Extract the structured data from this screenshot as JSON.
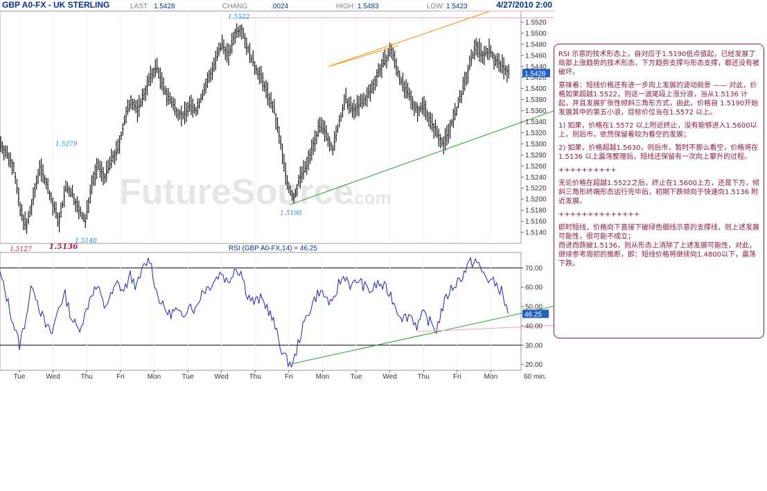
{
  "header": {
    "title": "GBP A0-FX - UK STERLING",
    "last_label": "LAST:",
    "last_value": "1.5428",
    "change_label": "CHANG",
    "change_value": ".0024",
    "high_label": "HIGH:",
    "high_value": "1.5483",
    "low_label": "LOW:",
    "low_value": "1.5423",
    "datetime": "4/27/2010 2:00"
  },
  "watermark": {
    "main": "FutureSource",
    "suffix": ".com"
  },
  "chart_data": [
    {
      "type": "bar",
      "subtype": "ohlc-price",
      "title": "GBP A0-FX - UK STERLING",
      "interval": "60 min.",
      "ylim": [
        1.512,
        1.554
      ],
      "yticks": [
        "1.5520",
        "1.5500",
        "1.5480",
        "1.5460",
        "1.5440",
        "1.5420",
        "1.5400",
        "1.5380",
        "1.5360",
        "1.5340",
        "1.5320",
        "1.5300",
        "1.5280",
        "1.5260",
        "1.5240",
        "1.5220",
        "1.5200",
        "1.5180",
        "1.5160",
        "1.5140"
      ],
      "last_value_label": "1.5428",
      "x_labels": [
        "Tue",
        "Wed",
        "Thu",
        "Fri",
        "Mon",
        "Tue",
        "Wed",
        "Thu",
        "Fri",
        "Mon",
        "Tue",
        "Wed",
        "Thu",
        "Fri",
        "Mon"
      ],
      "x_unit_label": "60 min.",
      "close_path": [
        [
          0,
          1.53
        ],
        [
          4,
          1.528
        ],
        [
          8,
          1.526
        ],
        [
          12,
          1.518
        ],
        [
          16,
          1.515
        ],
        [
          20,
          1.52
        ],
        [
          24,
          1.526
        ],
        [
          28,
          1.523
        ],
        [
          32,
          1.519
        ],
        [
          36,
          1.516
        ],
        [
          40,
          1.522
        ],
        [
          44,
          1.521
        ],
        [
          48,
          1.518
        ],
        [
          52,
          1.516
        ],
        [
          56,
          1.523
        ],
        [
          60,
          1.526
        ],
        [
          64,
          1.524
        ],
        [
          68,
          1.527
        ],
        [
          72,
          1.529
        ],
        [
          76,
          1.534
        ],
        [
          80,
          1.538
        ],
        [
          84,
          1.536
        ],
        [
          88,
          1.539
        ],
        [
          92,
          1.542
        ],
        [
          96,
          1.544
        ],
        [
          100,
          1.54
        ],
        [
          104,
          1.538
        ],
        [
          108,
          1.536
        ],
        [
          112,
          1.535
        ],
        [
          116,
          1.537
        ],
        [
          120,
          1.536
        ],
        [
          124,
          1.539
        ],
        [
          128,
          1.542
        ],
        [
          132,
          1.545
        ],
        [
          136,
          1.548
        ],
        [
          140,
          1.546
        ],
        [
          144,
          1.55
        ],
        [
          148,
          1.551
        ],
        [
          152,
          1.547
        ],
        [
          156,
          1.544
        ],
        [
          160,
          1.542
        ],
        [
          164,
          1.539
        ],
        [
          168,
          1.536
        ],
        [
          172,
          1.53
        ],
        [
          176,
          1.523
        ],
        [
          180,
          1.52
        ],
        [
          184,
          1.524
        ],
        [
          188,
          1.526
        ],
        [
          192,
          1.53
        ],
        [
          196,
          1.533
        ],
        [
          200,
          1.532
        ],
        [
          204,
          1.529
        ],
        [
          208,
          1.534
        ],
        [
          212,
          1.538
        ],
        [
          216,
          1.536
        ],
        [
          220,
          1.537
        ],
        [
          224,
          1.538
        ],
        [
          228,
          1.54
        ],
        [
          232,
          1.543
        ],
        [
          236,
          1.545
        ],
        [
          240,
          1.547
        ],
        [
          244,
          1.543
        ],
        [
          248,
          1.54
        ],
        [
          252,
          1.538
        ],
        [
          256,
          1.536
        ],
        [
          260,
          1.537
        ],
        [
          264,
          1.534
        ],
        [
          268,
          1.532
        ],
        [
          272,
          1.53
        ],
        [
          276,
          1.533
        ],
        [
          280,
          1.536
        ],
        [
          284,
          1.54
        ],
        [
          288,
          1.544
        ],
        [
          292,
          1.548
        ],
        [
          296,
          1.546
        ],
        [
          300,
          1.547
        ],
        [
          304,
          1.545
        ],
        [
          308,
          1.544
        ],
        [
          312,
          1.5428
        ]
      ],
      "annotations": [
        {
          "text": "1.5522",
          "x": 146,
          "y": 1.553,
          "color": "blue"
        },
        {
          "text": "1.5279",
          "x": 40,
          "y": 1.53,
          "color": "blue"
        },
        {
          "text": "1.5127",
          "x": 12,
          "y": 1.511,
          "color": "red"
        },
        {
          "text": "1.5136",
          "x": 36,
          "y": 1.5114,
          "color": "red-big"
        },
        {
          "text": "1.5140",
          "x": 52,
          "y": 1.5125,
          "color": "blue"
        },
        {
          "text": "1.5190",
          "x": 178,
          "y": 1.5175,
          "color": "blue"
        }
      ],
      "trendlines": [
        {
          "color": "orange",
          "from": [
            202,
            1.544
          ],
          "to": [
            301,
            1.554
          ]
        },
        {
          "color": "orange",
          "from": [
            202,
            1.544
          ],
          "to": [
            245,
            1.5478
          ]
        },
        {
          "color": "green",
          "from": [
            178,
            1.519
          ],
          "to": [
            320,
            1.536
          ]
        },
        {
          "color": "pink",
          "from": [
            146,
            1.5528
          ],
          "to": [
            320,
            1.5528
          ]
        },
        {
          "color": "pink",
          "from": [
            270,
            1.554
          ],
          "to": [
            320,
            1.554
          ]
        }
      ]
    },
    {
      "type": "line",
      "title": "RSI (GBP A0-FX,14) = 46.25",
      "series": [
        {
          "name": "RSI (GBP A0-FX,14)"
        }
      ],
      "ylim": [
        17,
        78
      ],
      "yticks": [
        "70.00",
        "60.00",
        "50.00",
        "40.00",
        "30.00",
        "20.00"
      ],
      "hlines": [
        70,
        30
      ],
      "last_value_label": "46.25",
      "values": [
        [
          0,
          67
        ],
        [
          4,
          55
        ],
        [
          8,
          42
        ],
        [
          12,
          30
        ],
        [
          16,
          45
        ],
        [
          20,
          62
        ],
        [
          24,
          50
        ],
        [
          28,
          40
        ],
        [
          32,
          36
        ],
        [
          36,
          50
        ],
        [
          40,
          56
        ],
        [
          44,
          44
        ],
        [
          48,
          38
        ],
        [
          52,
          45
        ],
        [
          56,
          57
        ],
        [
          60,
          60
        ],
        [
          64,
          50
        ],
        [
          68,
          55
        ],
        [
          72,
          62
        ],
        [
          76,
          58
        ],
        [
          80,
          66
        ],
        [
          84,
          60
        ],
        [
          88,
          70
        ],
        [
          92,
          75
        ],
        [
          96,
          58
        ],
        [
          100,
          50
        ],
        [
          104,
          46
        ],
        [
          108,
          48
        ],
        [
          112,
          44
        ],
        [
          116,
          52
        ],
        [
          120,
          48
        ],
        [
          124,
          58
        ],
        [
          128,
          60
        ],
        [
          132,
          64
        ],
        [
          136,
          68
        ],
        [
          140,
          62
        ],
        [
          144,
          70
        ],
        [
          148,
          68
        ],
        [
          152,
          56
        ],
        [
          156,
          52
        ],
        [
          160,
          54
        ],
        [
          164,
          50
        ],
        [
          168,
          42
        ],
        [
          172,
          30
        ],
        [
          176,
          22
        ],
        [
          180,
          20
        ],
        [
          184,
          34
        ],
        [
          188,
          44
        ],
        [
          192,
          52
        ],
        [
          196,
          58
        ],
        [
          200,
          55
        ],
        [
          204,
          50
        ],
        [
          208,
          62
        ],
        [
          212,
          66
        ],
        [
          216,
          60
        ],
        [
          220,
          64
        ],
        [
          224,
          60
        ],
        [
          228,
          58
        ],
        [
          232,
          62
        ],
        [
          236,
          60
        ],
        [
          240,
          56
        ],
        [
          244,
          48
        ],
        [
          248,
          44
        ],
        [
          252,
          46
        ],
        [
          256,
          40
        ],
        [
          260,
          46
        ],
        [
          264,
          42
        ],
        [
          268,
          38
        ],
        [
          272,
          50
        ],
        [
          276,
          58
        ],
        [
          280,
          62
        ],
        [
          284,
          66
        ],
        [
          288,
          72
        ],
        [
          292,
          74
        ],
        [
          296,
          68
        ],
        [
          300,
          64
        ],
        [
          304,
          62
        ],
        [
          308,
          58
        ],
        [
          312,
          46.25
        ]
      ],
      "trendlines": [
        {
          "color": "green",
          "from": [
            180,
            20.5
          ],
          "to": [
            320,
            47
          ]
        },
        {
          "color": "pink",
          "from": [
            256,
            37
          ],
          "to": [
            320,
            37
          ]
        }
      ]
    }
  ],
  "commentary": {
    "paragraphs": [
      "RSI 示意的技术形态上，自对应于1.5190低点值起，已经发展了局部上涨趋势的技术形态，下方趋势支撑与形态支撑，都还没有被破坏。",
      "意味着：短线价格还有进一步向上发展的波动前景 —— 对此，价格如果超越1.5522，则这一波尾段上涨分浪，当从1.5136 计起，并且发展扩张性倾斜三角形方式，由此，价格自 1.5190开始发展其中的第五小浪，目标价位当在1.5572 以上。",
      "1) 如果，价格在1.5572 以上附近终止，没有能够进入1.5600以上，则后市，依然保留着较为看空的发展；",
      "2) 如果，价格超越1.5630，则后市，暂时不那么看空，价格将在1.5136 以上震荡整理后，短线还保留有一次向上攀升的过程。",
      "++++++++++",
      "无论价格在超越1.5522之后，终止在1.5600上方，还是下方，倾斜三角形终端形态运行完毕后，初期下跌倾向于快速向1.5136 附近发展。",
      "++++++++++++++",
      "即时短线，价格向下直接下破绿色细线示意的支撑线，则上述发展可能性，很可能不成立；\n而进而跌破1.5136，则从形态上消除了上述发展可能性，对此，继续参考周初的推断，即：短线价格将继续向1.4800以下，震荡下跌。"
    ]
  },
  "colors": {
    "price_bars": "#000000",
    "rsi_line": "#1f1fbf",
    "orange_trend": "#ff8c00",
    "green_trend": "#2ea02e",
    "pink_line": "#f4a0b4",
    "frame": "#8b1a3a",
    "header_text": "#003399",
    "last_value_box": "#1f5fbf"
  }
}
